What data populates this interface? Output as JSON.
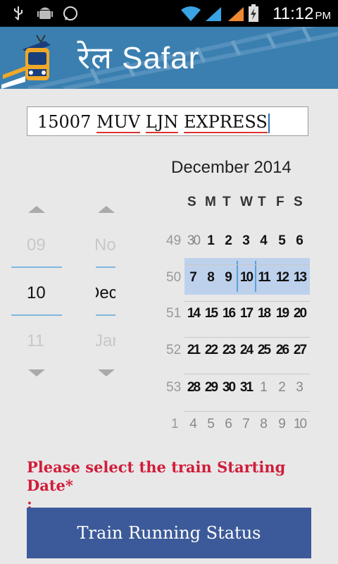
{
  "status_bar": {
    "icons": [
      "usb-icon",
      "android-debug-icon",
      "whatsapp-icon",
      "wifi-icon",
      "signal-icon",
      "signal-icon",
      "battery-charging-icon"
    ],
    "time": "11:12",
    "ampm": "PM"
  },
  "header": {
    "title": "रेल Safar"
  },
  "train_input": {
    "value_number": "15007",
    "value_words": [
      "MUV",
      "LJN",
      "EXPRESS"
    ]
  },
  "date_picker": {
    "day": {
      "prev": "09",
      "selected": "10",
      "next": "11"
    },
    "month": {
      "prev": "Nov",
      "selected": "Dec",
      "next": "Jan"
    }
  },
  "calendar": {
    "title": "December 2014",
    "weekdays": [
      "S",
      "M",
      "T",
      "W",
      "T",
      "F",
      "S"
    ],
    "weeks": [
      {
        "week": "49",
        "days": [
          "30",
          "1",
          "2",
          "3",
          "4",
          "5",
          "6"
        ],
        "other": [
          true,
          false,
          false,
          false,
          false,
          false,
          false
        ]
      },
      {
        "week": "50",
        "days": [
          "7",
          "8",
          "9",
          "10",
          "11",
          "12",
          "13"
        ],
        "other": [
          false,
          false,
          false,
          false,
          false,
          false,
          false
        ]
      },
      {
        "week": "51",
        "days": [
          "14",
          "15",
          "16",
          "17",
          "18",
          "19",
          "20"
        ],
        "other": [
          false,
          false,
          false,
          false,
          false,
          false,
          false
        ]
      },
      {
        "week": "52",
        "days": [
          "21",
          "22",
          "23",
          "24",
          "25",
          "26",
          "27"
        ],
        "other": [
          false,
          false,
          false,
          false,
          false,
          false,
          false
        ]
      },
      {
        "week": "53",
        "days": [
          "28",
          "29",
          "30",
          "31",
          "1",
          "2",
          "3"
        ],
        "other": [
          false,
          false,
          false,
          false,
          true,
          true,
          true
        ]
      },
      {
        "week": "1",
        "days": [
          "4",
          "5",
          "6",
          "7",
          "8",
          "9",
          "10"
        ],
        "other": [
          true,
          true,
          true,
          true,
          true,
          true,
          true
        ]
      }
    ],
    "selected_week": "50"
  },
  "prompt": {
    "line1": "Please select the train Starting Date*",
    "line2": ":"
  },
  "button": {
    "label": "Train Running Status"
  },
  "colors": {
    "header": "#3a7fb0",
    "button": "#3c5a99",
    "prompt": "#d11c3a",
    "selection": "#bdd1ec"
  }
}
